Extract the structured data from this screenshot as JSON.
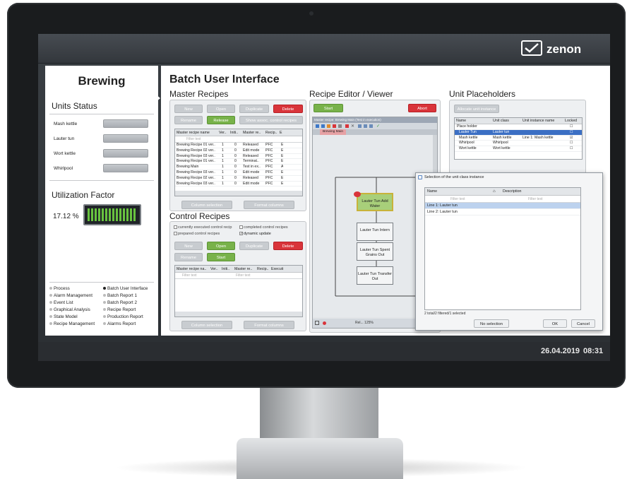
{
  "header": {
    "logo_text": "zenon"
  },
  "footer": {
    "date": "26.04.2019",
    "time": "08:31"
  },
  "left_panel": {
    "title": "Brewing",
    "units_status_title": "Units Status",
    "units": [
      "Mash kettle",
      "Lauter tun",
      "Wort kettle",
      "Whirlpool"
    ],
    "utilization_title": "Utilization Factor",
    "utilization_value": "17.12 %",
    "nav_left": [
      "Process",
      "Alarm Management",
      "Event List",
      "Graphical Analysis",
      "State Model",
      "Recipe Management"
    ],
    "nav_right": [
      "Batch User Interface",
      "Batch Report 1",
      "Batch Report 2",
      "Recipe Report",
      "Production Report",
      "Alarms Report"
    ]
  },
  "main": {
    "title": "Batch User Interface",
    "master": {
      "title": "Master Recipes",
      "buttons": [
        "New",
        "Open",
        "Duplicate",
        "Delete",
        "Rename",
        "Release",
        "Show assoc. control recipes"
      ],
      "columns": [
        "Master recipe name",
        "Ver..",
        "Initi..",
        "Master re..",
        "Recip..",
        "E"
      ],
      "filter": "Filter text",
      "rows": [
        [
          "Brewing Recipe 01 ver..",
          "1",
          "0",
          "Released",
          "PFC",
          "E"
        ],
        [
          "Brewing Recipe 02 ver..",
          "1",
          "0",
          "Edit mode",
          "PFC",
          "E"
        ],
        [
          "Brewing Recipe 03 ver..",
          "1",
          "0",
          "Released",
          "PFC",
          "E"
        ],
        [
          "Brewing Recipe 01 ver..",
          "1",
          "0",
          "Terminat..",
          "PFC",
          "E"
        ],
        [
          "Brewing Main",
          "1",
          "0",
          "Test in ex..",
          "PFC",
          "A"
        ],
        [
          "Brewing Recipe 03 ver..",
          "1",
          "0",
          "Edit mode",
          "PFC",
          "E"
        ],
        [
          "Brewing Recipe 02 ver..",
          "1",
          "0",
          "Released",
          "PFC",
          "E"
        ],
        [
          "Brewing Recipe 03 ver..",
          "1",
          "0",
          "Edit mode",
          "PFC",
          "E"
        ]
      ],
      "column_selection": "Column selection",
      "format_columns": "Format columns"
    },
    "control": {
      "title": "Control Recipes",
      "checks": [
        "currently executed control recip",
        "completed control recipes",
        "prepared control recipes",
        "dynamic update"
      ],
      "buttons": [
        "New",
        "Open",
        "Duplicate",
        "Delete",
        "Rename",
        "Start"
      ],
      "columns": [
        "Master recipe na..",
        "Ver..",
        "Initi..",
        "Master re..",
        "Recip..",
        "Executi"
      ],
      "filter": "Filter text",
      "column_selection": "Column selection",
      "format_columns": "Format columns"
    },
    "editor": {
      "title": "Recipe Editor / Viewer",
      "start": "Start",
      "abort": "Abort",
      "window_title": "Master recipe: Brewing Main (Test in execution)",
      "tab": "Brewing Main",
      "steps": [
        "Lauter Tun Add Water",
        "Lauter Tun Intern",
        "Lauter Tun Spent Grains Out",
        "Lauter Tun Transfer Out"
      ],
      "status": "Rel...    125%"
    },
    "placeholders": {
      "title": "Unit Placeholders",
      "allocate": "Allocate unit instance",
      "columns": [
        "Name",
        "Unit class",
        "Unit instance name",
        "Locked"
      ],
      "rows": [
        [
          "Place holder",
          "",
          "",
          ""
        ],
        [
          "Lauter Tun",
          "Lauter tun",
          "",
          ""
        ],
        [
          "Mash kettle",
          "Mash kettle",
          "Line 1: Mash kettle",
          "☑"
        ],
        [
          "Whirlpool",
          "Whirlpool",
          "",
          ""
        ],
        [
          "Wort kettle",
          "Wort kettle",
          "",
          ""
        ]
      ]
    },
    "dialog": {
      "title": "Selection of the unit class instance",
      "col_name": "Name",
      "col_desc": "Description",
      "filter": "Filter text",
      "rows": [
        "Line 1: Lauter tun",
        "Line 2: Lauter tun"
      ],
      "status": "2 total/2 filtered/1 selected",
      "no_selection": "No selection",
      "ok": "OK",
      "cancel": "Cancel"
    }
  }
}
